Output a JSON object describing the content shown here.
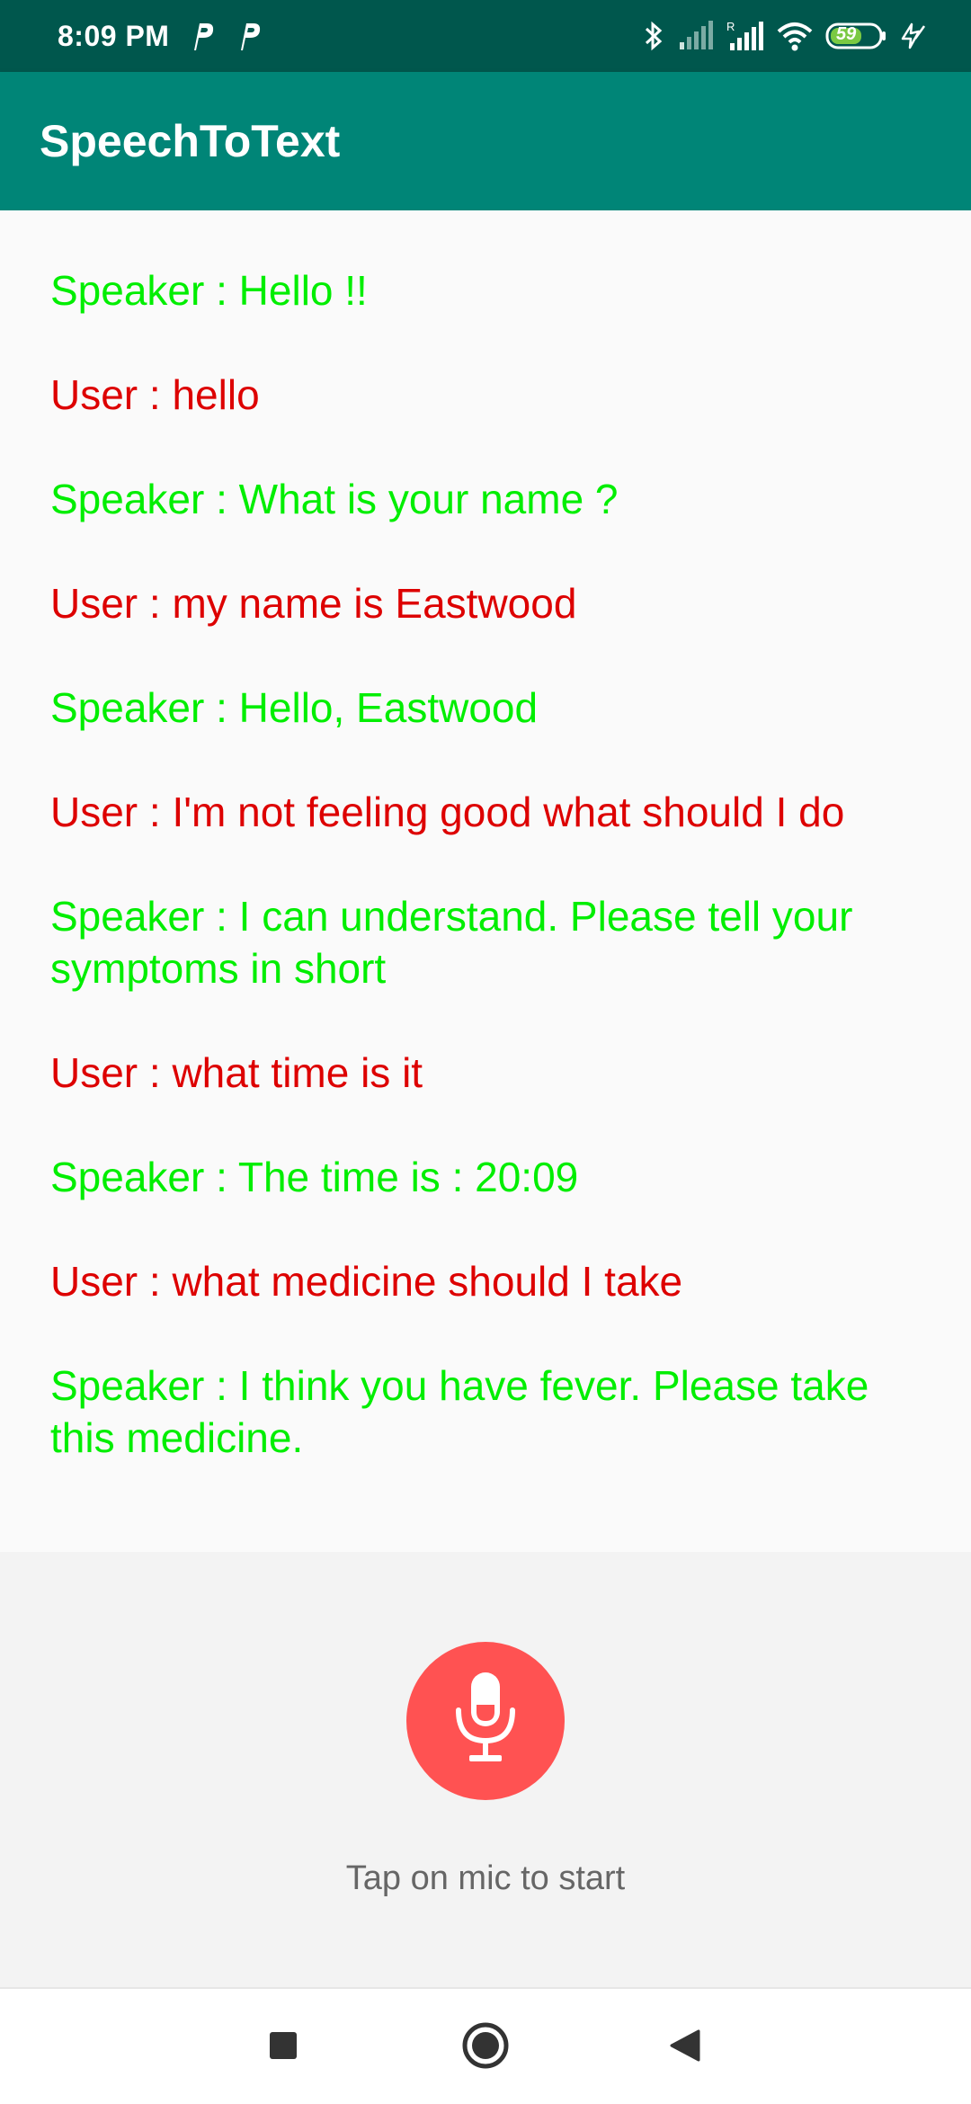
{
  "status_bar": {
    "time": "8:09 PM",
    "battery": "59",
    "icons": [
      "parking-notification-icon",
      "parking-notification-icon",
      "bluetooth-icon",
      "signal-icon",
      "signal-roaming-icon",
      "wifi-icon",
      "battery-icon",
      "charging-icon"
    ]
  },
  "app_bar": {
    "title": "SpeechToText"
  },
  "conversation": [
    {
      "role": "speaker",
      "text": "Speaker : Hello !!"
    },
    {
      "role": "user",
      "text": "User : hello"
    },
    {
      "role": "speaker",
      "text": "Speaker : What is your name ?"
    },
    {
      "role": "user",
      "text": "User : my name is Eastwood"
    },
    {
      "role": "speaker",
      "text": "Speaker : Hello, Eastwood"
    },
    {
      "role": "user",
      "text": "User : I'm not feeling good what should I do"
    },
    {
      "role": "speaker",
      "text": "Speaker : I can understand. Please tell your symptoms in short"
    },
    {
      "role": "user",
      "text": "User : what time is it"
    },
    {
      "role": "speaker",
      "text": "Speaker : The time is : 20:09"
    },
    {
      "role": "user",
      "text": "User : what medicine should I take"
    },
    {
      "role": "speaker",
      "text": "Speaker : I think you have fever. Please take this medicine."
    }
  ],
  "mic": {
    "hint": "Tap on mic to start",
    "icon": "microphone-icon"
  },
  "colors": {
    "status_bar": "#00574d",
    "app_bar": "#008577",
    "speaker_text": "#00ee00",
    "user_text": "#dd0000",
    "mic_button": "#ff5252"
  },
  "nav_bar": {
    "icons": [
      "recents-icon",
      "home-icon",
      "back-icon"
    ]
  }
}
